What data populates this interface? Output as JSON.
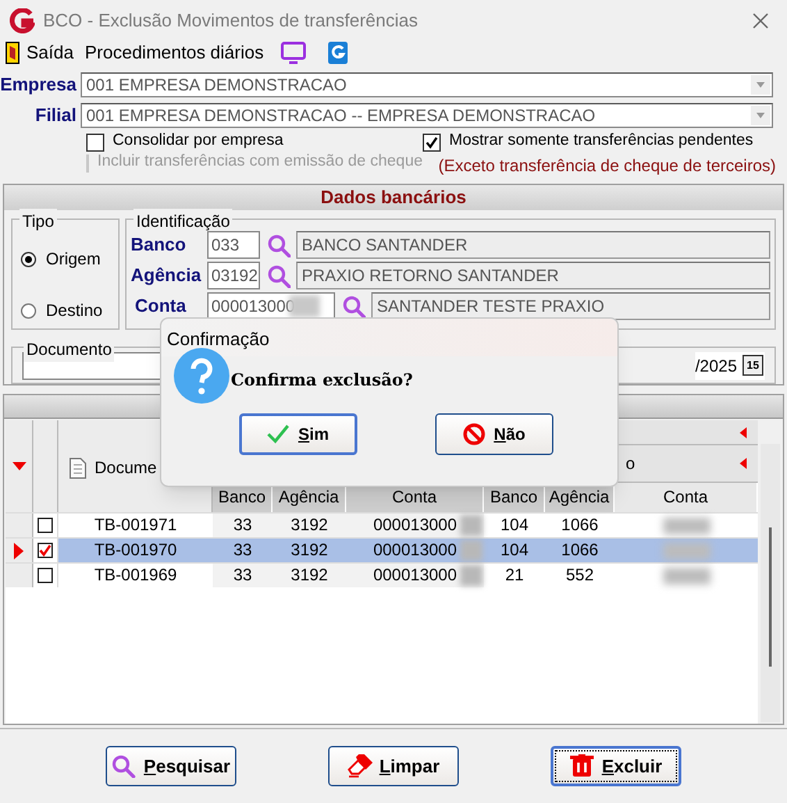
{
  "window": {
    "title": "BCO - Exclusão Movimentos de transferências"
  },
  "toolbar": [
    {
      "kind": "exit",
      "label": "Saída"
    },
    {
      "kind": "menu",
      "label": "Procedimentos diários"
    }
  ],
  "filters": {
    "empresa": {
      "label": "Empresa",
      "value": "001 EMPRESA DEMONSTRACAO"
    },
    "filial": {
      "label": "Filial",
      "value": "001 EMPRESA DEMONSTRACAO -- EMPRESA DEMONSTRACAO"
    },
    "checkboxes": [
      {
        "label": "Consolidar por empresa",
        "checked": false,
        "disabled": false
      },
      {
        "label": "Mostrar somente transferências pendentes",
        "checked": true,
        "disabled": false
      },
      {
        "label": "Incluir transferências com emissão de cheque",
        "checked": false,
        "disabled": true
      }
    ],
    "note": "(Exceto transferência de cheque de terceiros)"
  },
  "bank_panel": {
    "title": "Dados bancários",
    "tipo": {
      "label": "Tipo",
      "options": [
        {
          "label": "Origem",
          "selected": true
        },
        {
          "label": "Destino",
          "selected": false
        }
      ]
    },
    "identificacao": {
      "label": "Identificação",
      "fields": [
        {
          "label": "Banco",
          "code": "033",
          "name": "BANCO SANTANDER"
        },
        {
          "label": "Agência",
          "code": "03192",
          "name": "PRAXIO RETORNO SANTANDER"
        },
        {
          "label": "Conta",
          "code": "000013000",
          "name": "SANTANDER TESTE PRAXIO"
        }
      ]
    }
  },
  "documento": {
    "label": "Documento",
    "date": "/2025",
    "calendar_day": "15"
  },
  "grid": {
    "document_header": "Docume",
    "group_header_2": "o",
    "columns": [
      "Banco",
      "Agência",
      "Conta",
      "Banco",
      "Agência",
      "Conta"
    ],
    "rows": [
      {
        "document": "TB-001971",
        "cells": [
          "33",
          "3192",
          "000013000",
          "104",
          "1066"
        ],
        "checked": false,
        "selected": false
      },
      {
        "document": "TB-001970",
        "cells": [
          "33",
          "3192",
          "000013000",
          "104",
          "1066"
        ],
        "checked": true,
        "selected": true
      },
      {
        "document": "TB-001969",
        "cells": [
          "33",
          "3192",
          "000013000",
          "21",
          "552"
        ],
        "checked": false,
        "selected": false
      }
    ]
  },
  "dialog": {
    "title": "Confirmação",
    "message": "Confirma exclusão?",
    "buttons": [
      {
        "kind": "confirm",
        "label": "Sim"
      },
      {
        "kind": "cancel",
        "label": "Não"
      }
    ]
  },
  "buttons": [
    {
      "kind": "search",
      "label": "Pesquisar",
      "focused": false
    },
    {
      "kind": "clear",
      "label": "Limpar",
      "focused": false
    },
    {
      "kind": "delete",
      "label": "Excluir",
      "focused": true
    }
  ]
}
